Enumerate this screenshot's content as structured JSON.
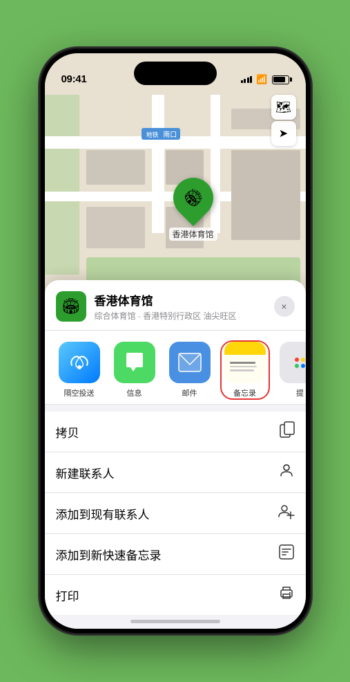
{
  "status_bar": {
    "time": "09:41",
    "location_arrow": "▶"
  },
  "map": {
    "subway_label": "南口",
    "pin_label": "香港体育馆"
  },
  "map_controls": {
    "layers_icon": "🗺",
    "location_icon": "➤"
  },
  "bottom_sheet": {
    "place_icon": "🏟",
    "place_name": "香港体育馆",
    "place_subtitle": "综合体育馆 · 香港特别行政区 油尖旺区",
    "close_label": "×"
  },
  "apps": [
    {
      "id": "airdrop",
      "label": "隔空投送",
      "icon_type": "airdrop"
    },
    {
      "id": "messages",
      "label": "信息",
      "icon_type": "messages"
    },
    {
      "id": "mail",
      "label": "邮件",
      "icon_type": "mail"
    },
    {
      "id": "notes",
      "label": "备忘录",
      "icon_type": "notes"
    },
    {
      "id": "more",
      "label": "提",
      "icon_type": "more"
    }
  ],
  "actions": [
    {
      "id": "copy",
      "label": "拷贝",
      "icon": "⎘"
    },
    {
      "id": "new-contact",
      "label": "新建联系人",
      "icon": "👤"
    },
    {
      "id": "add-existing",
      "label": "添加到现有联系人",
      "icon": "👤"
    },
    {
      "id": "quick-note",
      "label": "添加到新快速备忘录",
      "icon": "🖊"
    },
    {
      "id": "print",
      "label": "打印",
      "icon": "🖨"
    }
  ]
}
